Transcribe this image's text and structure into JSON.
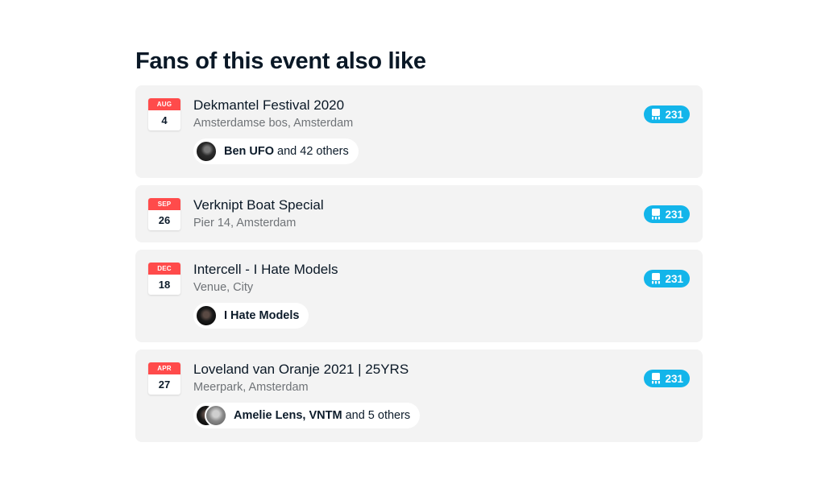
{
  "section": {
    "title": "Fans of this event also like"
  },
  "events": [
    {
      "month": "AUG",
      "day": "4",
      "title": "Dekmantel Festival 2020",
      "venue": "Amsterdamse bos, Amsterdam",
      "count": "231",
      "fans": {
        "names": "Ben UFO",
        "rest": "and 42 others"
      }
    },
    {
      "month": "SEP",
      "day": "26",
      "title": "Verknipt Boat Special",
      "venue": "Pier 14, Amsterdam",
      "count": "231"
    },
    {
      "month": "DEC",
      "day": "18",
      "title": "Intercell - I Hate Models",
      "venue": "Venue, City",
      "count": "231",
      "fans": {
        "names": "I Hate Models",
        "rest": ""
      }
    },
    {
      "month": "APR",
      "day": "27",
      "title": "Loveland van Oranje 2021 | 25YRS",
      "venue": "Meerpark, Amsterdam",
      "count": "231",
      "fans": {
        "names": "Amelie Lens, VNTM",
        "rest": "and 5 others"
      }
    }
  ],
  "colors": {
    "accent": "#13b5ea",
    "date_header": "#ff4b4b",
    "card_bg": "#f3f3f3"
  },
  "icons": {
    "count_badge": "ticket-stack-icon"
  }
}
